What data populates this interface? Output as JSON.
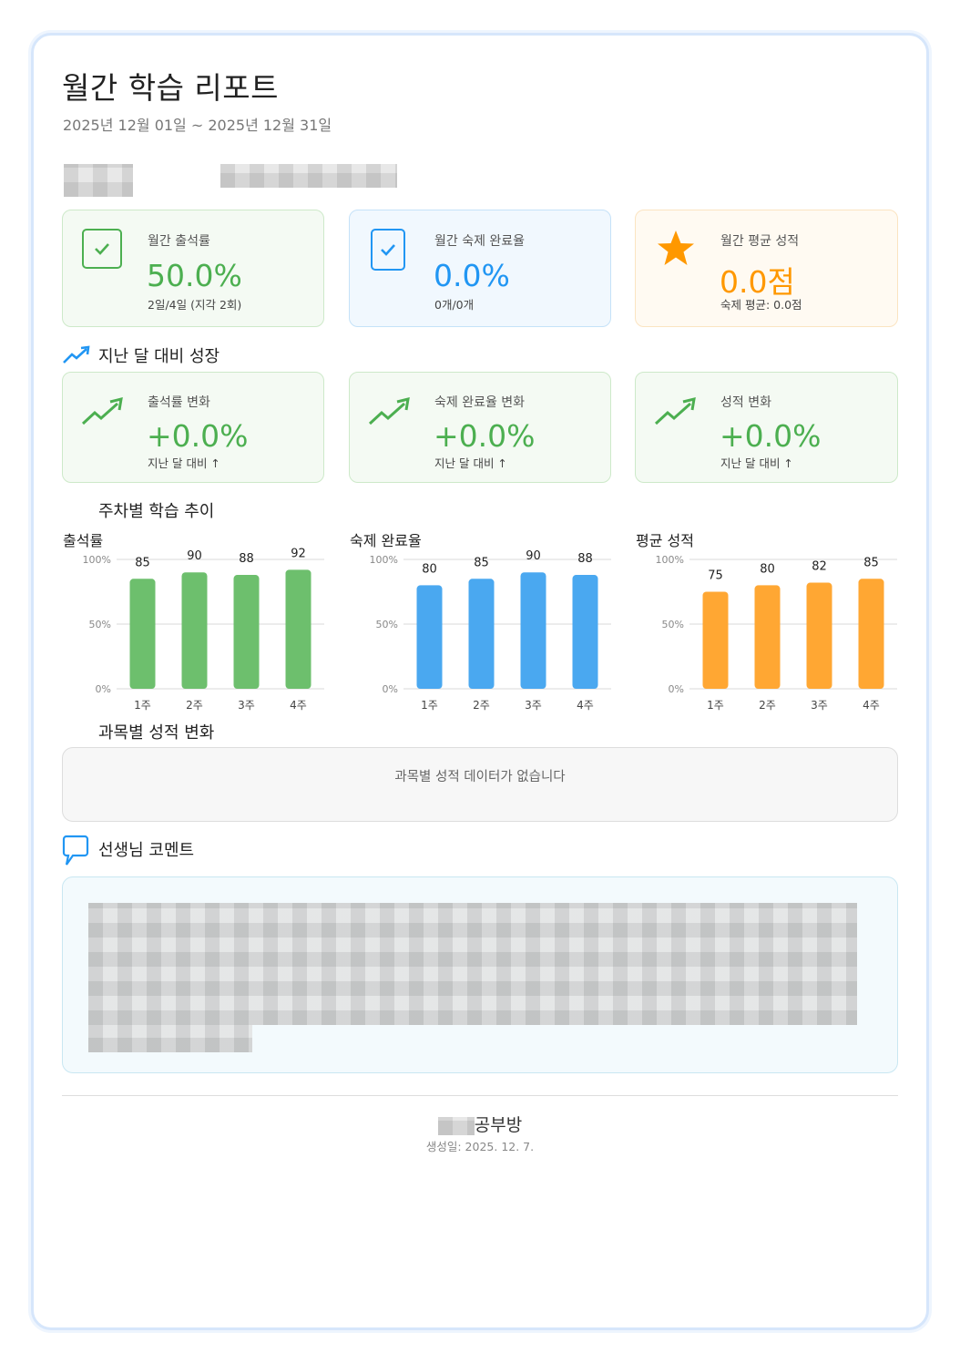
{
  "report": {
    "title": "월간 학습 리포트",
    "period": "2025년 12월 01일 ~ 2025년 12월 31일"
  },
  "summary": [
    {
      "label": "월간 출석률",
      "value": "50.0%",
      "sub": "2일/4일 (지각 2회)",
      "icon": "checkbox-icon",
      "color": "#4caf50"
    },
    {
      "label": "월간 숙제 완료율",
      "value": "0.0%",
      "sub": "0개/0개",
      "icon": "checkbox-icon",
      "color": "#2196f3"
    },
    {
      "label": "월간 평균 성적",
      "value": "0.0점",
      "sub": "숙제 평균: 0.0점",
      "icon": "star-icon",
      "color": "#ff9800"
    }
  ],
  "growth": {
    "title": "지난 달 대비 성장",
    "cards": [
      {
        "label": "출석률 변화",
        "value": "+0.0%",
        "sub": "지난 달 대비 ↑"
      },
      {
        "label": "숙제 완료율 변화",
        "value": "+0.0%",
        "sub": "지난 달 대비 ↑"
      },
      {
        "label": "성적 변화",
        "value": "+0.0%",
        "sub": "지난 달 대비 ↑"
      }
    ],
    "color": "#4caf50"
  },
  "weekly": {
    "title": "주차별 학습 추이"
  },
  "chart_data": [
    {
      "type": "bar",
      "title": "출석률",
      "categories": [
        "1주",
        "2주",
        "3주",
        "4주"
      ],
      "values": [
        85,
        90,
        88,
        92
      ],
      "ylim": [
        0,
        100
      ],
      "yticks": [
        "100%",
        "50%",
        "0%"
      ],
      "color": "#6dbf6d",
      "grid": true
    },
    {
      "type": "bar",
      "title": "숙제 완료율",
      "categories": [
        "1주",
        "2주",
        "3주",
        "4주"
      ],
      "values": [
        80,
        85,
        90,
        88
      ],
      "ylim": [
        0,
        100
      ],
      "yticks": [
        "100%",
        "50%",
        "0%"
      ],
      "color": "#4aa8f0",
      "grid": true
    },
    {
      "type": "bar",
      "title": "평균 성적",
      "categories": [
        "1주",
        "2주",
        "3주",
        "4주"
      ],
      "values": [
        75,
        80,
        82,
        85
      ],
      "ylim": [
        0,
        100
      ],
      "yticks": [
        "100%",
        "50%",
        "0%"
      ],
      "color": "#ffa733",
      "grid": true
    }
  ],
  "subject": {
    "title": "과목별 성적 변화",
    "empty": "과목별 성적 데이터가 없습니다"
  },
  "comment": {
    "title": "선생님 코멘트"
  },
  "footer": {
    "name": "공부방",
    "date": "생성일: 2025. 12. 7."
  }
}
